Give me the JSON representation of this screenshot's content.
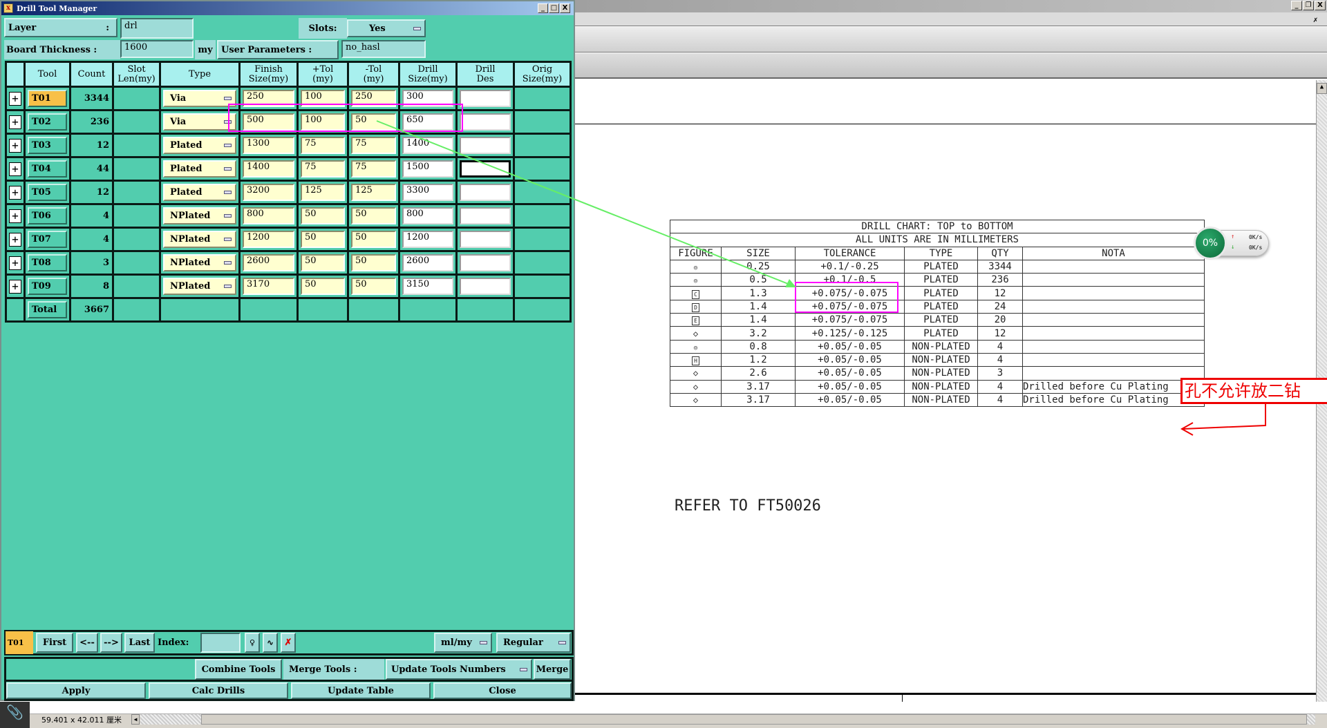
{
  "dialog": {
    "title": "Drill Tool Manager",
    "layer_label": "Layer",
    ":": ":",
    "layer_value": "drl",
    "slots_label": "Slots:",
    "slots_value": "Yes",
    "board_thickness_label": "Board Thickness :",
    "board_thickness_value": "1600",
    "board_thickness_unit": "my",
    "user_params_label": "User Parameters :",
    "user_params_value": "no_hasl",
    "columns": [
      "Tool",
      "Count",
      "Slot\nLen(my)",
      "Type",
      "Finish\nSize(my)",
      "+Tol\n(my)",
      "-Tol\n(my)",
      "Drill\nSize(my)",
      "Drill\nDes",
      "Orig\nSize(my)"
    ],
    "rows": [
      {
        "tool": "T01",
        "count": "3344",
        "type": "Via",
        "finish": "250",
        "ptol": "100",
        "ntol": "250",
        "drill": "300"
      },
      {
        "tool": "T02",
        "count": "236",
        "type": "Via",
        "finish": "500",
        "ptol": "100",
        "ntol": "50",
        "drill": "650"
      },
      {
        "tool": "T03",
        "count": "12",
        "type": "Plated",
        "finish": "1300",
        "ptol": "75",
        "ntol": "75",
        "drill": "1400"
      },
      {
        "tool": "T04",
        "count": "44",
        "type": "Plated",
        "finish": "1400",
        "ptol": "75",
        "ntol": "75",
        "drill": "1500"
      },
      {
        "tool": "T05",
        "count": "12",
        "type": "Plated",
        "finish": "3200",
        "ptol": "125",
        "ntol": "125",
        "drill": "3300"
      },
      {
        "tool": "T06",
        "count": "4",
        "type": "NPlated",
        "finish": "800",
        "ptol": "50",
        "ntol": "50",
        "drill": "800"
      },
      {
        "tool": "T07",
        "count": "4",
        "type": "NPlated",
        "finish": "1200",
        "ptol": "50",
        "ntol": "50",
        "drill": "1200"
      },
      {
        "tool": "T08",
        "count": "3",
        "type": "NPlated",
        "finish": "2600",
        "ptol": "50",
        "ntol": "50",
        "drill": "2600"
      },
      {
        "tool": "T09",
        "count": "8",
        "type": "NPlated",
        "finish": "3170",
        "ptol": "50",
        "ntol": "50",
        "drill": "3150"
      }
    ],
    "total_label": "Total",
    "total_count": "3667",
    "nav": {
      "current": "T01",
      "first": "First",
      "prev": "<--",
      "next": "-->",
      "last": "Last",
      "index_label": "Index:",
      "units": "ml/my",
      "mode": "Regular"
    },
    "combine_tools": "Combine Tools",
    "merge_tools_label": "Merge Tools :",
    "merge_option": "Update Tools Numbers",
    "merge": "Merge",
    "apply": "Apply",
    "calc_drills": "Calc Drills",
    "update_table": "Update Table",
    "close": "Close"
  },
  "drawing": {
    "chart_title": "DRILL CHART: TOP to BOTTOM",
    "units_note": "ALL UNITS ARE IN MILLIMETERS",
    "headers": [
      "FIGURE",
      "SIZE",
      "TOLERANCE",
      "TYPE",
      "QTY",
      "NOTA"
    ],
    "rows": [
      {
        "fig": "circle",
        "size": "0.25",
        "tol": "+0.1/-0.25",
        "type": "PLATED",
        "qty": "3344",
        "nota": ""
      },
      {
        "fig": "circle",
        "size": "0.5",
        "tol": "+0.1/-0.5",
        "type": "PLATED",
        "qty": "236",
        "nota": ""
      },
      {
        "fig": "C",
        "size": "1.3",
        "tol": "+0.075/-0.075",
        "type": "PLATED",
        "qty": "12",
        "nota": ""
      },
      {
        "fig": "D",
        "size": "1.4",
        "tol": "+0.075/-0.075",
        "type": "PLATED",
        "qty": "24",
        "nota": ""
      },
      {
        "fig": "E",
        "size": "1.4",
        "tol": "+0.075/-0.075",
        "type": "PLATED",
        "qty": "20",
        "nota": ""
      },
      {
        "fig": "diamond",
        "size": "3.2",
        "tol": "+0.125/-0.125",
        "type": "PLATED",
        "qty": "12",
        "nota": ""
      },
      {
        "fig": "circle",
        "size": "0.8",
        "tol": "+0.05/-0.05",
        "type": "NON-PLATED",
        "qty": "4",
        "nota": ""
      },
      {
        "fig": "H",
        "size": "1.2",
        "tol": "+0.05/-0.05",
        "type": "NON-PLATED",
        "qty": "4",
        "nota": ""
      },
      {
        "fig": "diamond",
        "size": "2.6",
        "tol": "+0.05/-0.05",
        "type": "NON-PLATED",
        "qty": "3",
        "nota": ""
      },
      {
        "fig": "diamond",
        "size": "3.17",
        "tol": "+0.05/-0.05",
        "type": "NON-PLATED",
        "qty": "4",
        "nota": "Drilled before Cu Plating"
      },
      {
        "fig": "diamond",
        "size": "3.17",
        "tol": "+0.05/-0.05",
        "type": "NON-PLATED",
        "qty": "4",
        "nota": "Drilled before Cu Plating"
      }
    ],
    "refer_text": "REFER TO FT50026",
    "annotation": "孔不允许放二钻",
    "net_percent": "0%",
    "net_up": "0K/s",
    "net_down": "0K/s"
  },
  "status": {
    "dimensions": "59.401 x 42.011 厘米"
  },
  "colors": {
    "teal": "#52cdae",
    "field": "#ffffd0",
    "highlight": "#ff00ff",
    "arrow": "#66ee66",
    "annotation": "#e00000"
  }
}
